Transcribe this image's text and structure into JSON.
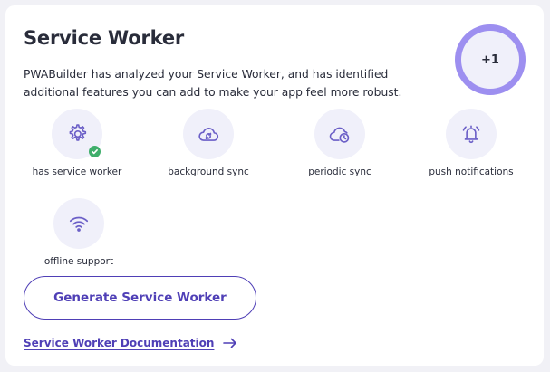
{
  "card": {
    "title": "Service Worker",
    "description": "PWABuilder has analyzed your Service Worker, and has identified additional features you can add to make your app feel more robust.",
    "score": "+1"
  },
  "features": [
    {
      "label": "has service worker",
      "icon": "gear-icon",
      "status": "detected"
    },
    {
      "label": "background sync",
      "icon": "cloud-sync-icon"
    },
    {
      "label": "periodic sync",
      "icon": "cloud-clock-icon"
    },
    {
      "label": "push notifications",
      "icon": "bell-ring-icon"
    },
    {
      "label": "offline support",
      "icon": "wifi-icon"
    }
  ],
  "actions": {
    "generate_label": "Generate Service Worker",
    "docs_link": "Service Worker Documentation"
  },
  "colors": {
    "accent": "#4f3fb6",
    "ring": "#9d8ff0",
    "bubble": "#f0f0fa",
    "success": "#3fae6b",
    "text": "#292c3a"
  }
}
